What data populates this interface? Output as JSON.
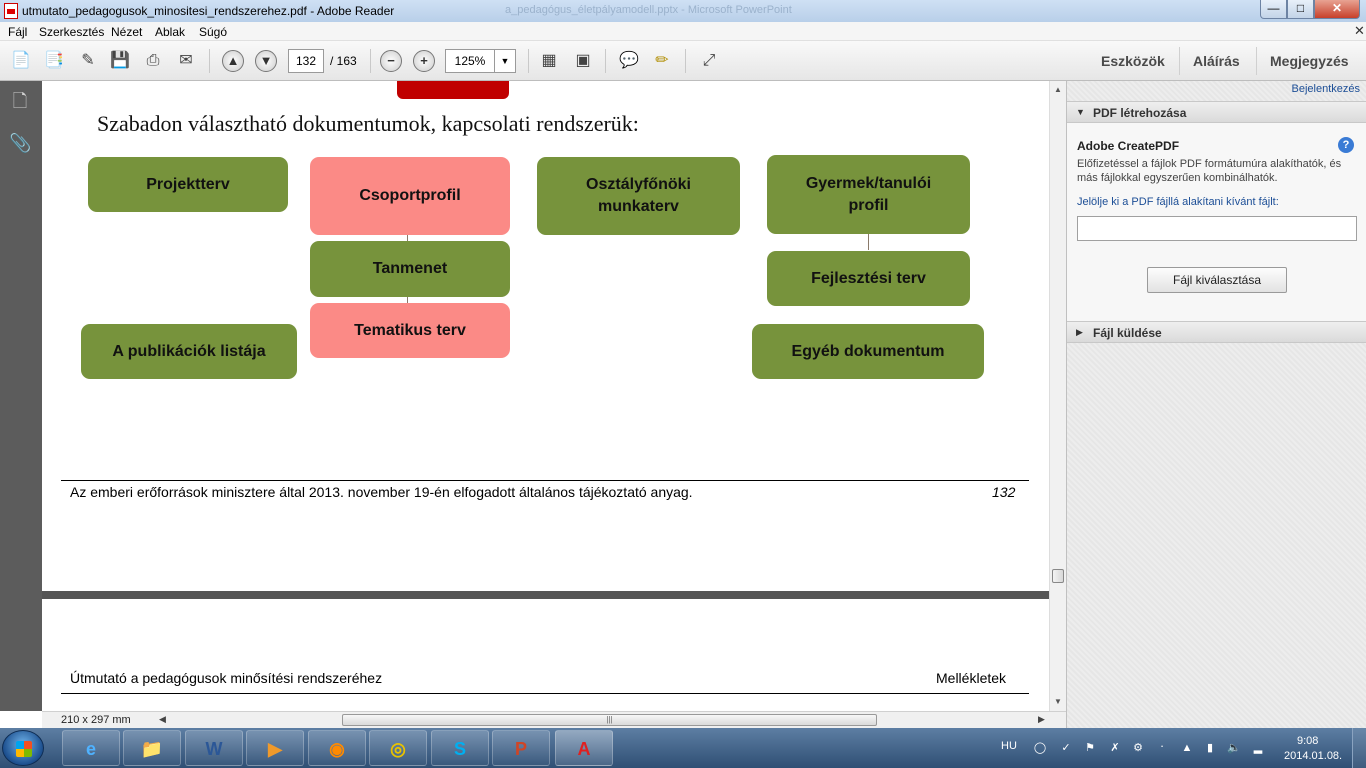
{
  "window": {
    "title": "utmutato_pedagogusok_minositesi_rendszerehez.pdf - Adobe Reader",
    "background_title": "a_pedagógus_életpályamodell.pptx - Microsoft PowerPoint",
    "min": "—",
    "max": "□",
    "close": "✕"
  },
  "menu": {
    "items": [
      "Fájl",
      "Szerkesztés",
      "Nézet",
      "Ablak",
      "Súgó"
    ],
    "close": "✕"
  },
  "toolbar": {
    "page_current": "132",
    "page_total": "/ 163",
    "zoom": "125%",
    "zoom_arrow": "▼",
    "minus": "−",
    "plus": "+",
    "prev": "▲",
    "next": "▼",
    "tools": "Eszközök",
    "sign": "Aláírás",
    "comment": "Megjegyzés",
    "icons": [
      "create-pdf-icon",
      "acrobat-icon",
      "edit-icon",
      "save-icon",
      "print-icon",
      "email-icon",
      "fit-page-icon",
      "fit-width-icon",
      "comment-icon",
      "highlight-icon",
      "fullscreen-icon"
    ]
  },
  "document": {
    "heading": "Szabadon választható dokumentumok, kapcsolati rendszerük:",
    "boxes": {
      "projektterv": "Projektterv",
      "csoportprofil": "Csoportprofil",
      "osztalyfonoki": "Osztályfőnöki munkaterv",
      "gyermek": "Gyermek/tanulói profil",
      "tanmenet": "Tanmenet",
      "fejlesztesi": "Fejlesztési terv",
      "tematikus": "Tematikus terv",
      "publikaciok": "A publikációk listája",
      "egyeb": "Egyéb dokumentum"
    },
    "colors": {
      "green": "#77933c",
      "pink": "#fb8a86",
      "red": "#c00000"
    },
    "footer_text": "Az emberi erőforrások minisztere által 2013. november 19-én elfogadott általános tájékoztató anyag.",
    "footer_page": "132",
    "next_page_left": "Útmutató a pedagógusok minősítési rendszeréhez",
    "next_page_right": "Mellékletek"
  },
  "statusbar": {
    "page_size": "210 x 297 mm"
  },
  "right_pane": {
    "login": "Bejelentkezés",
    "section_create": "PDF létrehozása",
    "create_title": "Adobe CreatePDF",
    "create_desc": "Előfizetéssel a fájlok PDF formátumúra alakíthatók, és más fájlokkal egyszerűen kombinálhatók.",
    "select_label": "Jelölje ki a PDF fájllá alakítani kívánt fájlt:",
    "select_value": "",
    "select_button": "Fájl kiválasztása",
    "section_send": "Fájl küldése"
  },
  "taskbar": {
    "apps": [
      "internet-explorer-icon",
      "windows-explorer-icon",
      "word-icon",
      "media-player-icon",
      "firefox-icon",
      "chrome-icon",
      "skype-icon",
      "powerpoint-icon",
      "adobe-reader-icon"
    ],
    "lang": "HU",
    "time": "9:08",
    "date": "2014.01.08."
  }
}
